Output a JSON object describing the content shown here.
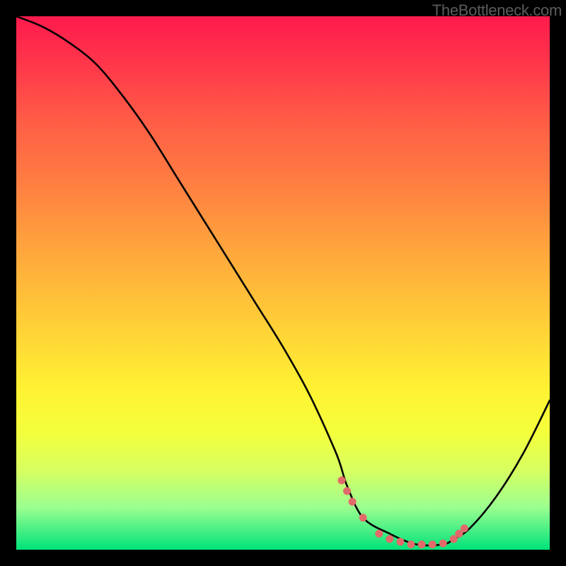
{
  "attribution": "TheBottleneck.com",
  "chart_data": {
    "type": "line",
    "title": "",
    "xlabel": "",
    "ylabel": "",
    "xlim": [
      0,
      100
    ],
    "ylim": [
      0,
      100
    ],
    "series": [
      {
        "name": "bottleneck-curve",
        "x": [
          0,
          5,
          10,
          15,
          20,
          25,
          30,
          35,
          40,
          45,
          50,
          55,
          60,
          62,
          65,
          70,
          75,
          80,
          82,
          85,
          90,
          95,
          100
        ],
        "y": [
          100,
          98,
          95,
          91,
          85,
          78,
          70,
          62,
          54,
          46,
          38,
          29,
          18,
          12,
          6,
          3,
          1,
          1,
          2,
          4,
          10,
          18,
          28
        ]
      }
    ],
    "markers": {
      "name": "optimal-range-dots",
      "color": "#e36a6a",
      "x": [
        61,
        62,
        63,
        65,
        68,
        70,
        72,
        74,
        76,
        78,
        80,
        82,
        83,
        84
      ],
      "y": [
        13,
        11,
        9,
        6,
        3,
        2,
        1.5,
        1,
        1,
        1,
        1.2,
        2,
        3,
        4
      ]
    },
    "background": {
      "type": "vertical-gradient",
      "stops": [
        {
          "pos": 0,
          "color": "#ff1a4d"
        },
        {
          "pos": 50,
          "color": "#ffb83a"
        },
        {
          "pos": 78,
          "color": "#f4ff3c"
        },
        {
          "pos": 100,
          "color": "#00e27a"
        }
      ]
    }
  }
}
